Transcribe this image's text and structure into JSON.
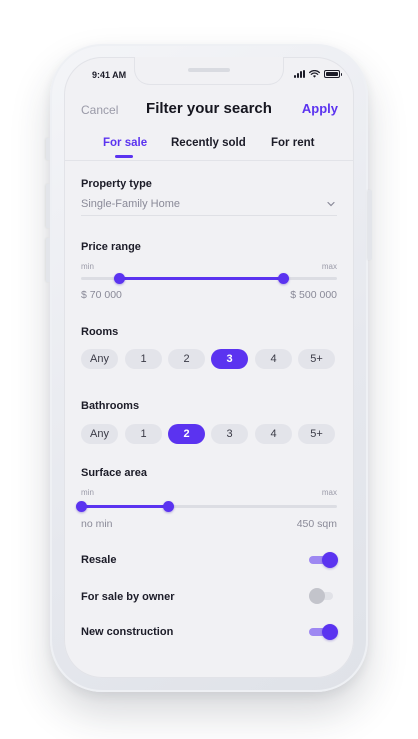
{
  "status_bar": {
    "time": "9:41 AM",
    "signal_icon": "cellular-signal-icon",
    "wifi_icon": "wifi-icon",
    "battery_icon": "battery-icon"
  },
  "header": {
    "cancel_label": "Cancel",
    "title": "Filter your search",
    "apply_label": "Apply"
  },
  "tabs": [
    {
      "label": "For sale",
      "active": true
    },
    {
      "label": "Recently sold",
      "active": false
    },
    {
      "label": "For rent",
      "active": false
    }
  ],
  "property_type": {
    "title": "Property type",
    "value": "Single-Family Home",
    "icon": "chevron-down-icon"
  },
  "price_range": {
    "title": "Price range",
    "min_label": "min",
    "max_label": "max",
    "low_value": "$ 70 000",
    "high_value": "$ 500 000",
    "low_fraction": 0.15,
    "high_fraction": 0.79
  },
  "rooms": {
    "title": "Rooms",
    "options": [
      "Any",
      "1",
      "2",
      "3",
      "4",
      "5+"
    ],
    "selected": "3"
  },
  "bathrooms": {
    "title": "Bathrooms",
    "options": [
      "Any",
      "1",
      "2",
      "3",
      "4",
      "5+"
    ],
    "selected": "2"
  },
  "surface_area": {
    "title": "Surface area",
    "min_label": "min",
    "max_label": "max",
    "low_value": "no min",
    "high_value": "450 sqm",
    "low_fraction": 0.0,
    "high_fraction": 0.34
  },
  "toggles": [
    {
      "label": "Resale",
      "on": true
    },
    {
      "label": "For sale by owner",
      "on": false
    },
    {
      "label": "New construction",
      "on": true
    }
  ],
  "colors": {
    "accent": "#5b33f0",
    "accent_light": "#9e88f2",
    "text": "#1c1c28",
    "muted": "#8a8a98",
    "background": "#f1f1f4"
  }
}
